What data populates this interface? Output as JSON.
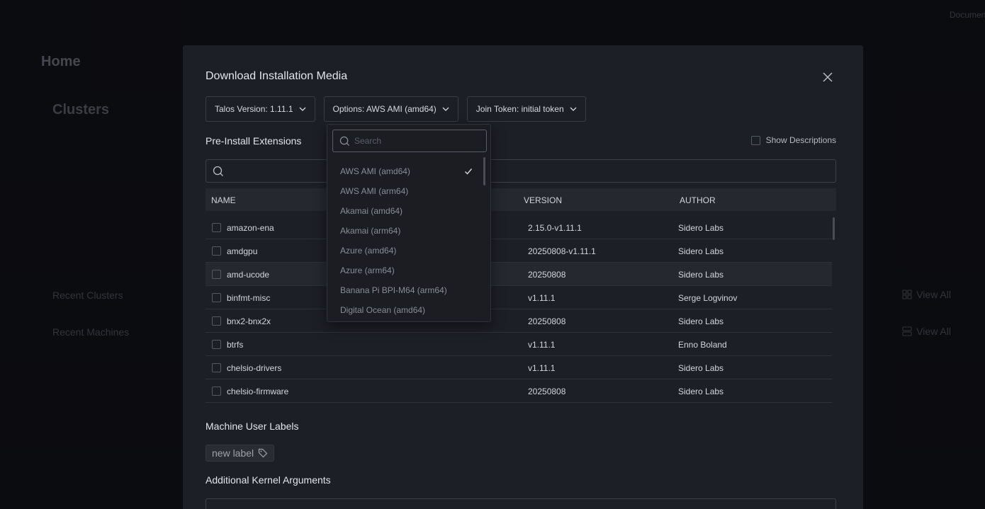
{
  "background": {
    "title": "Home",
    "clusters_heading": "Clusters",
    "recent_clusters": "Recent Clusters",
    "recent_machines": "Recent Machines",
    "view_all_label": "View All",
    "docs_label": "Documentation"
  },
  "modal": {
    "title": "Download Installation Media",
    "close_icon": "close-icon",
    "selects": {
      "talos_version": "Talos Version: 1.11.1",
      "options": "Options: AWS AMI (amd64)",
      "join_token": "Join Token: initial token"
    },
    "extensions": {
      "title": "Pre-Install Extensions",
      "show_descriptions": "Show Descriptions",
      "columns": {
        "name": "NAME",
        "version": "VERSION",
        "author": "AUTHOR"
      },
      "rows": [
        {
          "name": "amazon-ena",
          "version": "2.15.0-v1.11.1",
          "author": "Sidero Labs"
        },
        {
          "name": "amdgpu",
          "version": "20250808-v1.11.1",
          "author": "Sidero Labs"
        },
        {
          "name": "amd-ucode",
          "version": "20250808",
          "author": "Sidero Labs"
        },
        {
          "name": "binfmt-misc",
          "version": "v1.11.1",
          "author": "Serge Logvinov"
        },
        {
          "name": "bnx2-bnx2x",
          "version": "20250808",
          "author": "Sidero Labs"
        },
        {
          "name": "btrfs",
          "version": "v1.11.1",
          "author": "Enno Boland"
        },
        {
          "name": "chelsio-drivers",
          "version": "v1.11.1",
          "author": "Sidero Labs"
        },
        {
          "name": "chelsio-firmware",
          "version": "20250808",
          "author": "Sidero Labs"
        }
      ]
    },
    "labels": {
      "title": "Machine User Labels",
      "new_label": "new label"
    },
    "kernel": {
      "title": "Additional Kernel Arguments"
    }
  },
  "dropdown": {
    "search_placeholder": "Search",
    "selected": "AWS AMI (amd64)",
    "items": [
      "AWS AMI (amd64)",
      "AWS AMI (arm64)",
      "Akamai (amd64)",
      "Akamai (arm64)",
      "Azure (amd64)",
      "Azure (arm64)",
      "Banana Pi BPI-M64 (arm64)",
      "Digital Ocean (amd64)"
    ]
  }
}
